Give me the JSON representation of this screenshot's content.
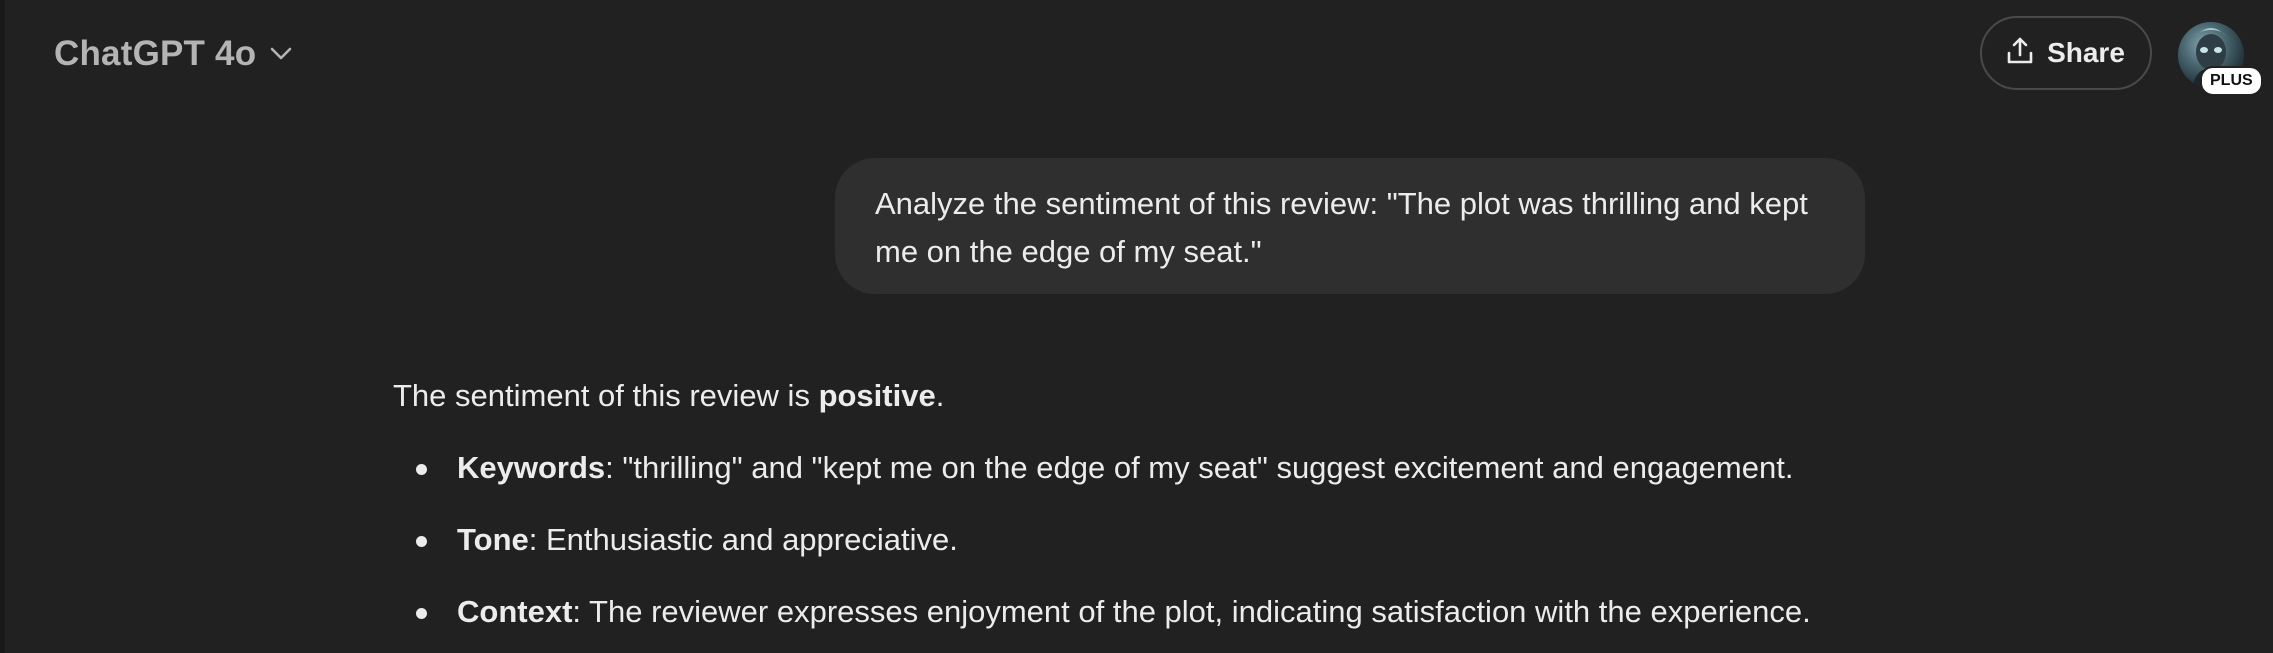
{
  "header": {
    "model_name": "ChatGPT 4o",
    "share_label": "Share",
    "plan_badge": "PLUS"
  },
  "icons": {
    "model_chevron": "chevron-down-icon",
    "share": "share-upload-icon",
    "avatar": "user-avatar"
  },
  "conversation": {
    "user_message": "Analyze the sentiment of this review: \"The plot was thrilling and kept me on the edge of my seat.\"",
    "assistant": {
      "intro_prefix": "The sentiment of this review is ",
      "intro_bold": "positive",
      "intro_suffix": ".",
      "bullets": [
        {
          "term": "Keywords",
          "text": ": \"thrilling\" and \"kept me on the edge of my seat\" suggest excitement and engagement."
        },
        {
          "term": "Tone",
          "text": ": Enthusiastic and appreciative."
        },
        {
          "term": "Context",
          "text": ": The reviewer expresses enjoyment of the plot, indicating satisfaction with the experience."
        }
      ]
    }
  },
  "colors": {
    "background": "#212121",
    "bubble": "#2f2f2f",
    "text": "#ececec",
    "muted_text": "#b4b4b4",
    "border": "#4a4a4a"
  }
}
